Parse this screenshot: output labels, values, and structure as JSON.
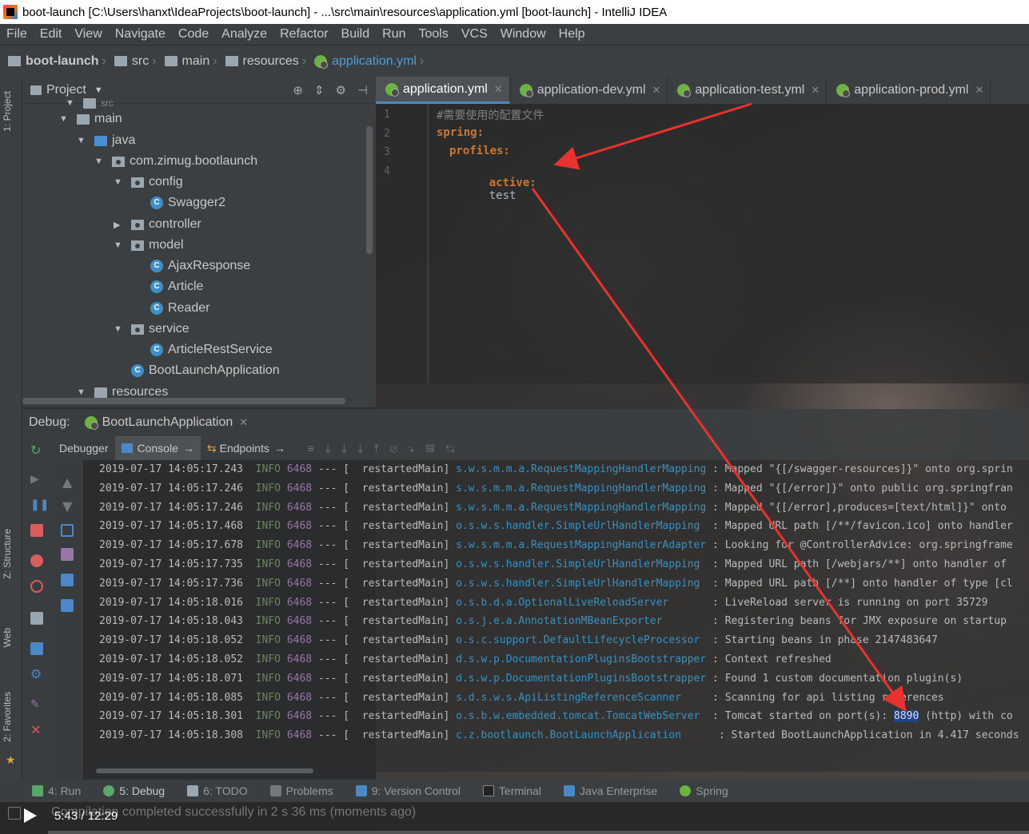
{
  "window": {
    "title": "boot-launch [C:\\Users\\hanxt\\IdeaProjects\\boot-launch] - ...\\src\\main\\resources\\application.yml [boot-launch] - IntelliJ IDEA"
  },
  "menu": [
    "File",
    "Edit",
    "View",
    "Navigate",
    "Code",
    "Analyze",
    "Refactor",
    "Build",
    "Run",
    "Tools",
    "VCS",
    "Window",
    "Help"
  ],
  "breadcrumb": [
    "boot-launch",
    "src",
    "main",
    "resources",
    "application.yml"
  ],
  "left_strip": {
    "project": "1: Project",
    "structure": "Z: Structure",
    "web": "Web",
    "favorites": "2: Favorites"
  },
  "project_panel": {
    "title": "Project",
    "tree": [
      {
        "label": "src"
      },
      {
        "label": "main"
      },
      {
        "label": "java"
      },
      {
        "label": "com.zimug.bootlaunch"
      },
      {
        "label": "config"
      },
      {
        "label": "Swagger2"
      },
      {
        "label": "controller"
      },
      {
        "label": "model"
      },
      {
        "label": "AjaxResponse"
      },
      {
        "label": "Article"
      },
      {
        "label": "Reader"
      },
      {
        "label": "service"
      },
      {
        "label": "ArticleRestService"
      },
      {
        "label": "BootLaunchApplication"
      },
      {
        "label": "resources"
      }
    ]
  },
  "editor_tabs": [
    "application.yml",
    "application-dev.yml",
    "application-test.yml",
    "application-prod.yml"
  ],
  "editor": {
    "line_numbers": [
      "1",
      "2",
      "3",
      "4"
    ],
    "comment": "#需要使用的配置文件",
    "spring_key": "spring:",
    "profiles_key": "profiles:",
    "active_key": "active:",
    "active_value": "test"
  },
  "debug": {
    "label": "Debug:",
    "run_config": "BootLaunchApplication",
    "tabs": [
      "Debugger",
      "Console",
      "Endpoints"
    ]
  },
  "console_lines": [
    {
      "ts": "2019-07-17 14:05:17.243",
      "level": "INFO",
      "pid": "6468",
      "thread": "--- [  restartedMain]",
      "logger": "s.w.s.m.m.a.RequestMappingHandlerMapping",
      "msg": ": Mapped \"{[/swagger-resources]}\" onto org.sprin"
    },
    {
      "ts": "2019-07-17 14:05:17.246",
      "level": "INFO",
      "pid": "6468",
      "thread": "--- [  restartedMain]",
      "logger": "s.w.s.m.m.a.RequestMappingHandlerMapping",
      "msg": ": Mapped \"{[/error]}\" onto public org.springfran"
    },
    {
      "ts": "2019-07-17 14:05:17.246",
      "level": "INFO",
      "pid": "6468",
      "thread": "--- [  restartedMain]",
      "logger": "s.w.s.m.m.a.RequestMappingHandlerMapping",
      "msg": ": Mapped \"{[/error],produces=[text/html]}\" onto"
    },
    {
      "ts": "2019-07-17 14:05:17.468",
      "level": "INFO",
      "pid": "6468",
      "thread": "--- [  restartedMain]",
      "logger": "o.s.w.s.handler.SimpleUrlHandlerMapping ",
      "msg": ": Mapped URL path [/**/favicon.ico] onto handler"
    },
    {
      "ts": "2019-07-17 14:05:17.678",
      "level": "INFO",
      "pid": "6468",
      "thread": "--- [  restartedMain]",
      "logger": "s.w.s.m.m.a.RequestMappingHandlerAdapter",
      "msg": ": Looking for @ControllerAdvice: org.springframe"
    },
    {
      "ts": "2019-07-17 14:05:17.735",
      "level": "INFO",
      "pid": "6468",
      "thread": "--- [  restartedMain]",
      "logger": "o.s.w.s.handler.SimpleUrlHandlerMapping ",
      "msg": ": Mapped URL path [/webjars/**] onto handler of"
    },
    {
      "ts": "2019-07-17 14:05:17.736",
      "level": "INFO",
      "pid": "6468",
      "thread": "--- [  restartedMain]",
      "logger": "o.s.w.s.handler.SimpleUrlHandlerMapping ",
      "msg": ": Mapped URL path [/**] onto handler of type [cl"
    },
    {
      "ts": "2019-07-17 14:05:18.016",
      "level": "INFO",
      "pid": "6468",
      "thread": "--- [  restartedMain]",
      "logger": "o.s.b.d.a.OptionalLiveReloadServer      ",
      "msg": ": LiveReload server is running on port 35729"
    },
    {
      "ts": "2019-07-17 14:05:18.043",
      "level": "INFO",
      "pid": "6468",
      "thread": "--- [  restartedMain]",
      "logger": "o.s.j.e.a.AnnotationMBeanExporter       ",
      "msg": ": Registering beans for JMX exposure on startup"
    },
    {
      "ts": "2019-07-17 14:05:18.052",
      "level": "INFO",
      "pid": "6468",
      "thread": "--- [  restartedMain]",
      "logger": "o.s.c.support.DefaultLifecycleProcessor ",
      "msg": ": Starting beans in phase 2147483647"
    },
    {
      "ts": "2019-07-17 14:05:18.052",
      "level": "INFO",
      "pid": "6468",
      "thread": "--- [  restartedMain]",
      "logger": "d.s.w.p.DocumentationPluginsBootstrapper",
      "msg": ": Context refreshed"
    },
    {
      "ts": "2019-07-17 14:05:18.071",
      "level": "INFO",
      "pid": "6468",
      "thread": "--- [  restartedMain]",
      "logger": "d.s.w.p.DocumentationPluginsBootstrapper",
      "msg": ": Found 1 custom documentation plugin(s)"
    },
    {
      "ts": "2019-07-17 14:05:18.085",
      "level": "INFO",
      "pid": "6468",
      "thread": "--- [  restartedMain]",
      "logger": "s.d.s.w.s.ApiListingReferenceScanner    ",
      "msg": ": Scanning for api listing references"
    },
    {
      "ts": "2019-07-17 14:05:18.301",
      "level": "INFO",
      "pid": "6468",
      "thread": "--- [  restartedMain]",
      "logger": "o.s.b.w.embedded.tomcat.TomcatWebServer ",
      "msg_pre": ": Tomcat started on port(s): ",
      "port": "8890",
      "msg_post": " (http) with co"
    },
    {
      "ts": "2019-07-17 14:05:18.308",
      "level": "INFO",
      "pid": "6468",
      "thread": "--- [  restartedMain]",
      "logger": "c.z.bootlaunch.BootLaunchApplication     ",
      "msg": ": Started BootLaunchApplication in 4.417 seconds"
    }
  ],
  "bottom_tabs": [
    "4: Run",
    "5: Debug",
    "6: TODO",
    "Problems",
    "9: Version Control",
    "Terminal",
    "Java Enterprise",
    "Spring"
  ],
  "status": {
    "message": "Compilation completed successfully in 2 s 36 ms (moments ago)",
    "video_time": "5:43 / 12:29"
  },
  "colors": {
    "accent": "#4a88c7",
    "annotation_arrow": "#e8322e",
    "yaml_key": "#cc7832",
    "log_level": "#6a8759",
    "logger": "#3592c4"
  }
}
